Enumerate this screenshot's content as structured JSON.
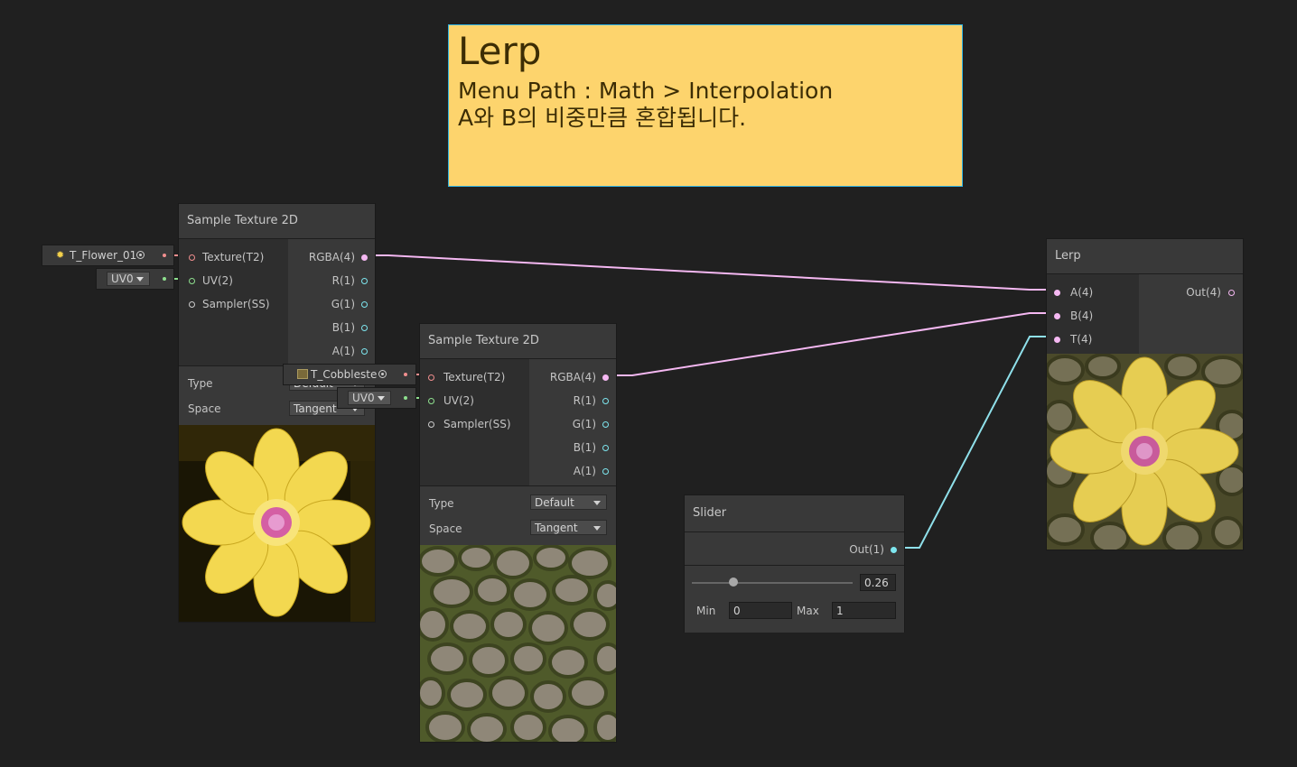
{
  "note": {
    "title": "Lerp",
    "line1": "Menu Path : Math > Interpolation",
    "line2": "A와 B의 비중만큼 혼합됩니다."
  },
  "colors": {
    "texture_port": "#f08e8e",
    "uv_port": "#8ee08e",
    "vector4_port": "#f5b8f2",
    "float_port": "#7ee6ef",
    "sampler_port": "#cccccc",
    "note_bg": "#fdd46d"
  },
  "node1": {
    "title": "Sample Texture 2D",
    "inputs": [
      "Texture(T2)",
      "UV(2)",
      "Sampler(SS)"
    ],
    "outputs": [
      "RGBA(4)",
      "R(1)",
      "G(1)",
      "B(1)",
      "A(1)"
    ],
    "type_label": "Type",
    "type_value": "Default",
    "space_label": "Space",
    "space_value": "Tangent",
    "texture_field": "T_Flower_01",
    "uv_value": "UV0"
  },
  "node2": {
    "title": "Sample Texture 2D",
    "inputs": [
      "Texture(T2)",
      "UV(2)",
      "Sampler(SS)"
    ],
    "outputs": [
      "RGBA(4)",
      "R(1)",
      "G(1)",
      "B(1)",
      "A(1)"
    ],
    "type_label": "Type",
    "type_value": "Default",
    "space_label": "Space",
    "space_value": "Tangent",
    "texture_field": "T_Cobbleste",
    "uv_value": "UV0"
  },
  "slider": {
    "title": "Slider",
    "output": "Out(1)",
    "value": "0.26",
    "level": 0.26,
    "min_label": "Min",
    "min_value": "0",
    "max_label": "Max",
    "max_value": "1"
  },
  "lerp": {
    "title": "Lerp",
    "inputs": [
      "A(4)",
      "B(4)",
      "T(4)"
    ],
    "output": "Out(4)"
  }
}
